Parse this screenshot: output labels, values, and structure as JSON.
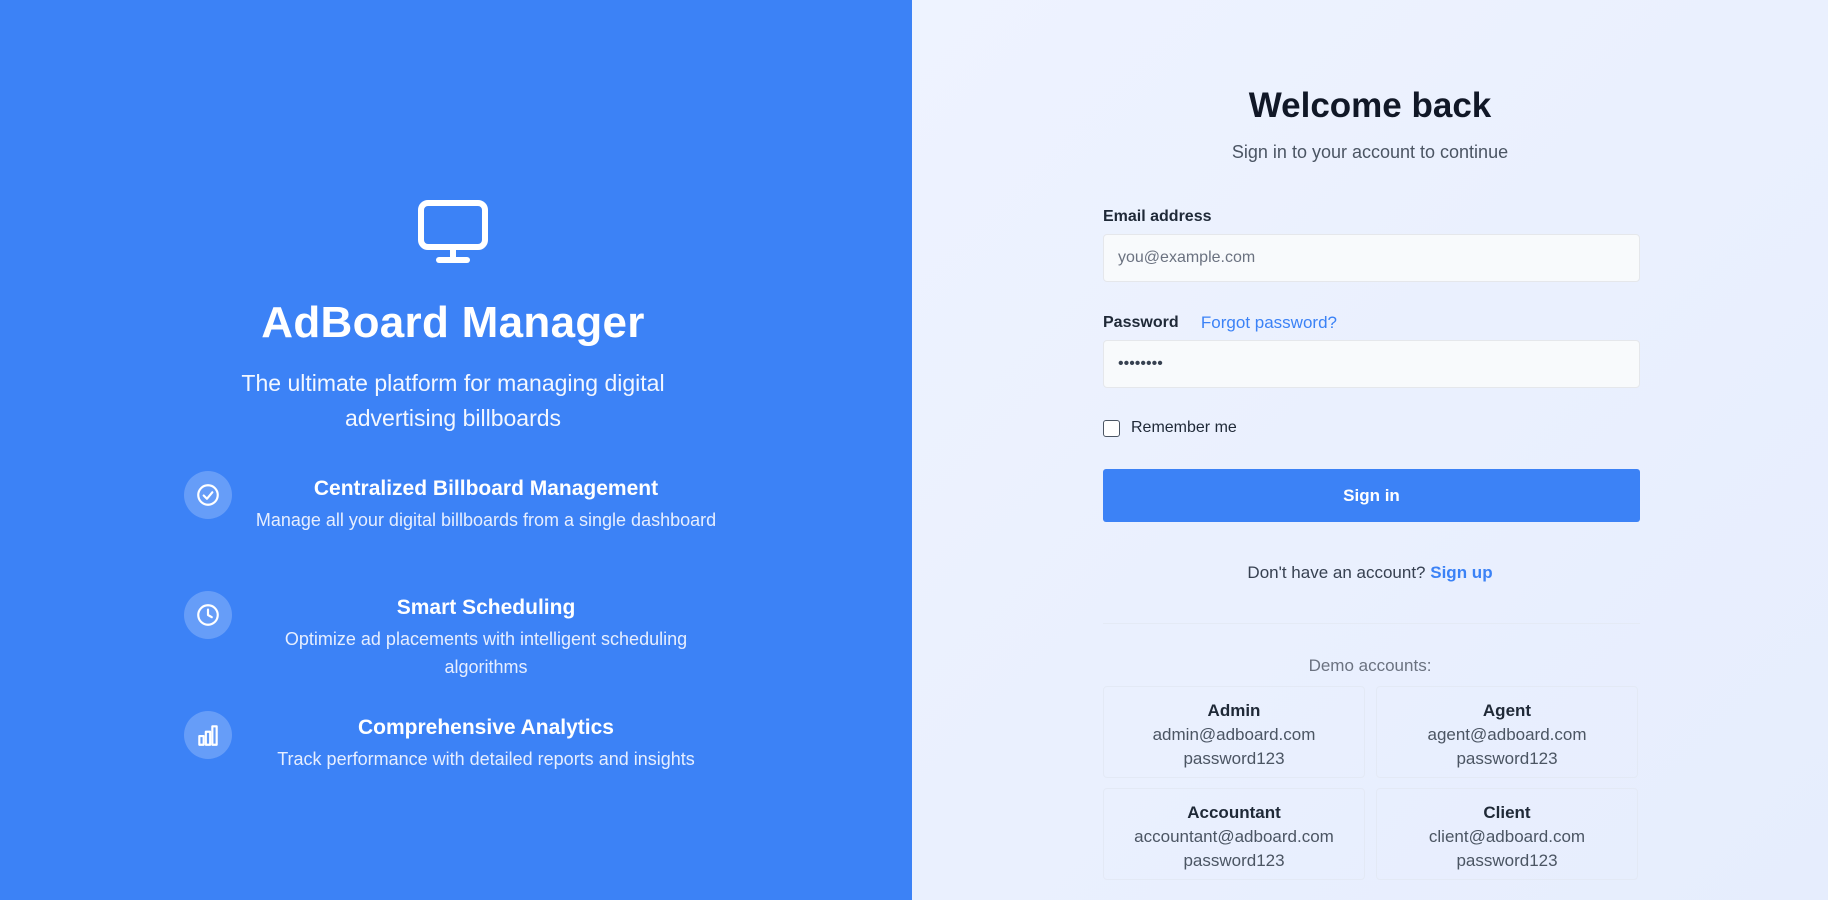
{
  "brand": {
    "name": "AdBoard Manager",
    "tagline": "The ultimate platform for managing digital advertising billboards",
    "logo_icon": "monitor-icon"
  },
  "features": [
    {
      "icon": "check-circle-icon",
      "title": "Centralized Billboard Management",
      "description": "Manage all your digital billboards from a single dashboard"
    },
    {
      "icon": "clock-icon",
      "title": "Smart Scheduling",
      "description": "Optimize ad placements with intelligent scheduling algorithms"
    },
    {
      "icon": "bar-chart-icon",
      "title": "Comprehensive Analytics",
      "description": "Track performance with detailed reports and insights"
    }
  ],
  "login": {
    "title": "Welcome back",
    "subtitle": "Sign in to your account to continue",
    "email_label": "Email address",
    "email_placeholder": "you@example.com",
    "email_value": "",
    "password_label": "Password",
    "password_value": "password",
    "forgot_link": "Forgot password?",
    "remember_label": "Remember me",
    "remember_checked": false,
    "signin_button": "Sign in",
    "signup_prompt": "Don't have an account?",
    "signup_link": "Sign up"
  },
  "demo": {
    "title": "Demo accounts:",
    "accounts": [
      {
        "role": "Admin",
        "email": "admin@adboard.com",
        "password": "password123"
      },
      {
        "role": "Agent",
        "email": "agent@adboard.com",
        "password": "password123"
      },
      {
        "role": "Accountant",
        "email": "accountant@adboard.com",
        "password": "password123"
      },
      {
        "role": "Client",
        "email": "client@adboard.com",
        "password": "password123"
      }
    ]
  },
  "colors": {
    "primary": "#3c82f6",
    "link": "#3b82f6",
    "heading": "#111827",
    "right_background": "#eaf0fd"
  }
}
